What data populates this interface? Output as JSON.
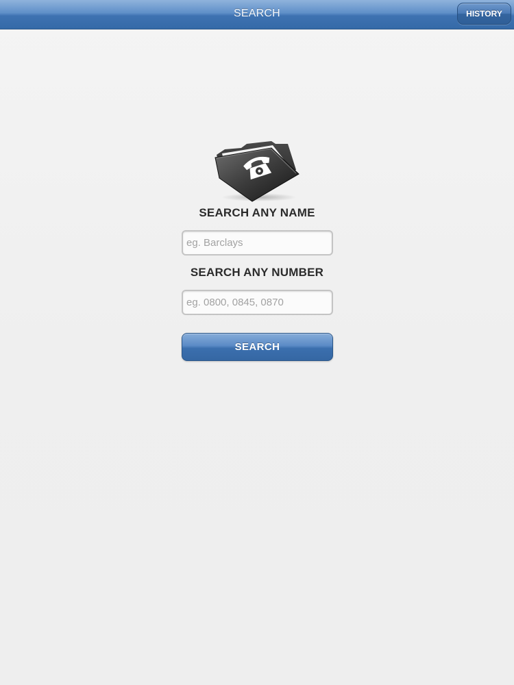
{
  "navbar": {
    "title": "SEARCH",
    "history_label": "HISTORY"
  },
  "logo": {
    "icon": "phone-folder-icon"
  },
  "name_section": {
    "label": "SEARCH ANY NAME",
    "placeholder": "eg. Barclays",
    "value": ""
  },
  "number_section": {
    "label": "SEARCH ANY NUMBER",
    "placeholder": "eg. 0800, 0845, 0870",
    "value": ""
  },
  "search_button": {
    "label": "SEARCH"
  },
  "colors": {
    "accent": "#3e72b1",
    "background": "#f0f0f0",
    "label_text": "#2b2b2b"
  }
}
